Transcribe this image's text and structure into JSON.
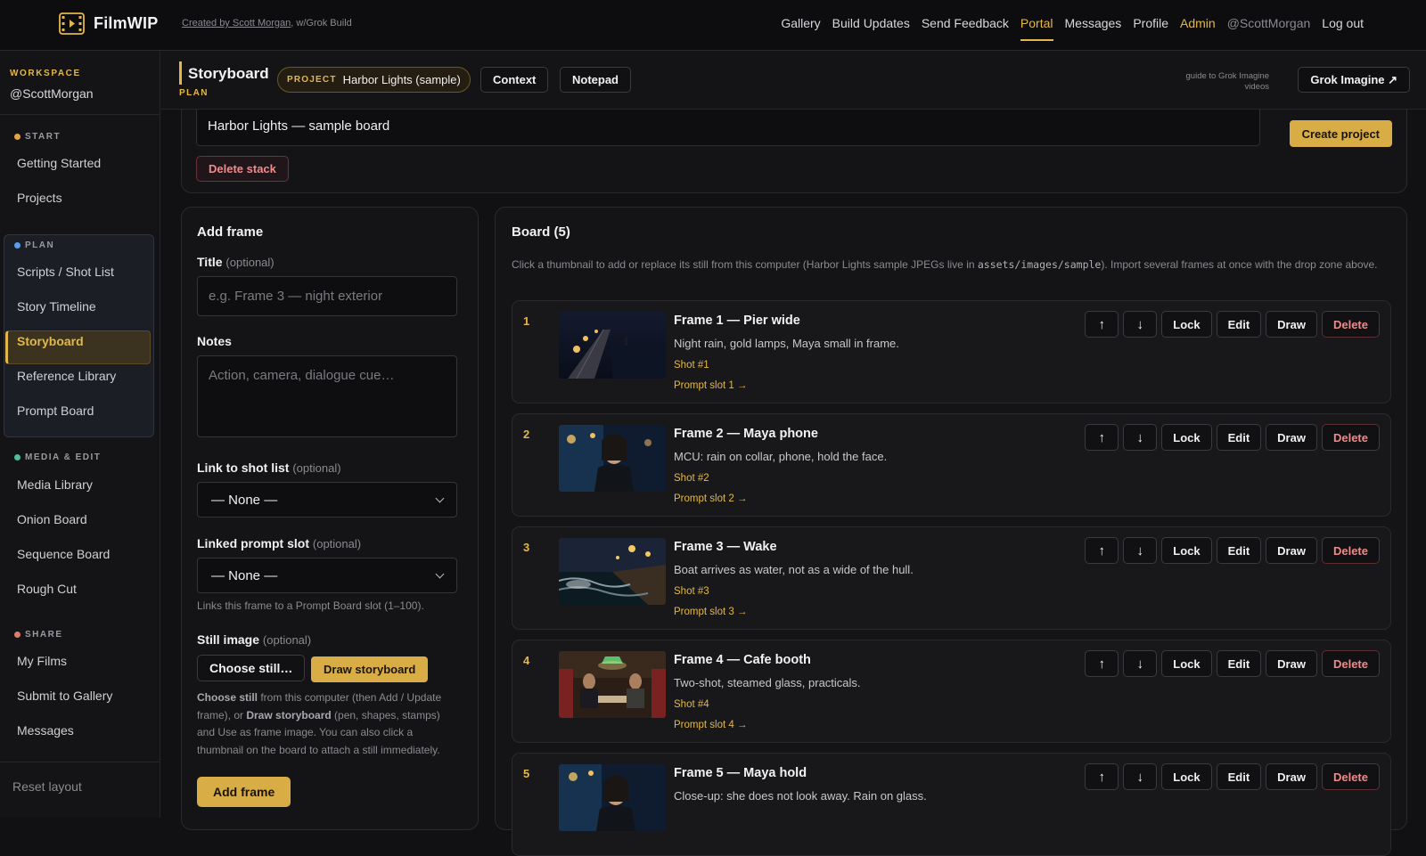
{
  "app": {
    "brand": "FilmWIP",
    "credit_author": "Created by Scott Morgan",
    "credit_rest": ", w/Grok Build"
  },
  "topnav": [
    {
      "label": "Gallery"
    },
    {
      "label": "Build Updates"
    },
    {
      "label": "Send Feedback"
    },
    {
      "label": "Portal"
    },
    {
      "label": "Messages"
    },
    {
      "label": "Profile"
    },
    {
      "label": "Admin"
    },
    {
      "label": "@ScottMorgan"
    },
    {
      "label": "Log out"
    }
  ],
  "sidebar": {
    "workspace_label": "WORKSPACE",
    "workspace_handle": "@ScottMorgan",
    "sections": {
      "start": {
        "label": "START",
        "color": "#e3a24a"
      },
      "plan": {
        "label": "PLAN",
        "color": "#5a9ee8"
      },
      "media": {
        "label": "MEDIA & EDIT",
        "color": "#4fbf9a"
      },
      "share": {
        "label": "SHARE",
        "color": "#e07b6a"
      }
    },
    "items": {
      "getting_started": "Getting Started",
      "projects": "Projects",
      "scripts": "Scripts / Shot List",
      "story_timeline": "Story Timeline",
      "storyboard": "Storyboard",
      "reference_library": "Reference Library",
      "prompt_board": "Prompt Board",
      "media_library": "Media Library",
      "onion_board": "Onion Board",
      "sequence_board": "Sequence Board",
      "rough_cut": "Rough Cut",
      "my_films": "My Films",
      "submit_gallery": "Submit to Gallery",
      "messages": "Messages"
    },
    "reset": "Reset layout"
  },
  "header": {
    "title": "Storyboard",
    "subtitle": "PLAN",
    "project_key": "PROJECT",
    "project_value": "Harbor Lights (sample)",
    "context_btn": "Context",
    "notepad_btn": "Notepad",
    "guide_text": "guide to Grok Imagine videos",
    "grok_btn": "Grok Imagine ↗"
  },
  "stack": {
    "name_value": "Harbor Lights — sample board",
    "create_btn": "Create project",
    "delete_btn": "Delete stack"
  },
  "add_frame": {
    "title": "Add frame",
    "title_label": "Title",
    "title_opt": "(optional)",
    "title_placeholder": "e.g. Frame 3 — night exterior",
    "notes_label": "Notes",
    "notes_placeholder": "Action, camera, dialogue cue…",
    "shot_label": "Link to shot list",
    "shot_opt": "(optional)",
    "shot_value": "— None —",
    "prompt_label": "Linked prompt slot",
    "prompt_opt": "(optional)",
    "prompt_value": "— None —",
    "prompt_hint": "Links this frame to a Prompt Board slot (1–100).",
    "still_label": "Still image",
    "still_opt": "(optional)",
    "choose_btn": "Choose still…",
    "draw_btn": "Draw storyboard",
    "hint_b1": "Choose still",
    "hint_t1": " from this computer (then Add / Update frame), or ",
    "hint_b2": "Draw storyboard",
    "hint_t2": " (pen, shapes, stamps) and Use as frame image. You can also click a thumbnail on the board to attach a still immediately.",
    "add_btn": "Add frame"
  },
  "board": {
    "title": "Board (5)",
    "desc_1": "Click a thumbnail to add or replace its still from this computer (Harbor Lights sample JPEGs live in ",
    "desc_code": "assets/images/sample",
    "desc_2": "). Import several frames at once with the drop zone above.",
    "actions": {
      "up": "↑",
      "down": "↓",
      "lock": "Lock",
      "edit": "Edit",
      "draw": "Draw",
      "delete": "Delete"
    },
    "frames": [
      {
        "num": "1",
        "title": "Frame 1 — Pier wide",
        "desc": "Night rain, gold lamps, Maya small in frame.",
        "shot": "Shot #1",
        "prompt": "Prompt slot 1 →"
      },
      {
        "num": "2",
        "title": "Frame 2 — Maya phone",
        "desc": "MCU: rain on collar, phone, hold the face.",
        "shot": "Shot #2",
        "prompt": "Prompt slot 2 →"
      },
      {
        "num": "3",
        "title": "Frame 3 — Wake",
        "desc": "Boat arrives as water, not as a wide of the hull.",
        "shot": "Shot #3",
        "prompt": "Prompt slot 3 →"
      },
      {
        "num": "4",
        "title": "Frame 4 — Cafe booth",
        "desc": "Two-shot, steamed glass, practicals.",
        "shot": "Shot #4",
        "prompt": "Prompt slot 4 →"
      },
      {
        "num": "5",
        "title": "Frame 5 — Maya hold",
        "desc": "Close-up: she does not look away. Rain on glass.",
        "shot": "",
        "prompt": ""
      }
    ]
  },
  "colors": {
    "accent": "#e3b848",
    "danger": "#f08a8a",
    "bg": "#111113"
  }
}
